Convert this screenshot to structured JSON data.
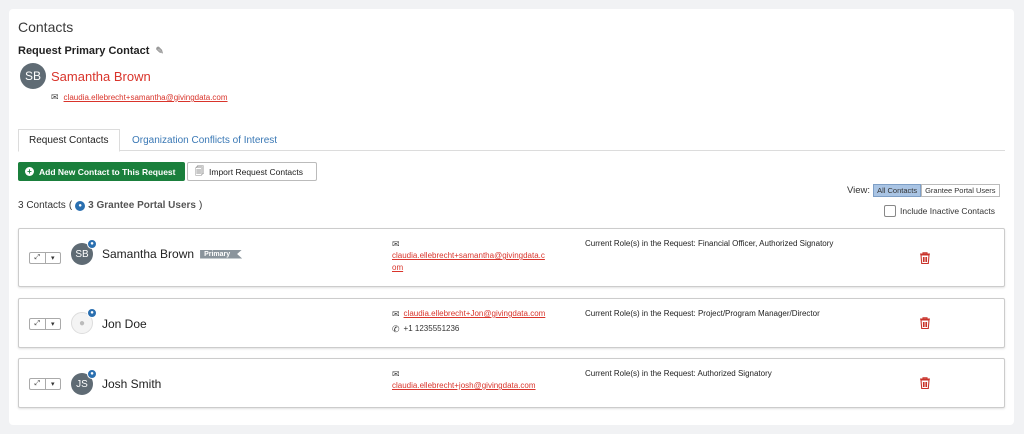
{
  "title": "Contacts",
  "primary_contact": {
    "label": "Request Primary Contact",
    "initials": "SB",
    "name": "Samantha Brown",
    "email": "claudia.ellebrecht+samantha@givingdata.com"
  },
  "tabs": [
    {
      "label": "Request Contacts",
      "active": true
    },
    {
      "label": "Organization Conflicts of Interest",
      "active": false
    }
  ],
  "buttons": {
    "add": "Add New Contact to This Request",
    "import": "Import Request Contacts"
  },
  "view": {
    "label": "View:",
    "options": [
      "All Contacts",
      "Grantee Portal Users"
    ],
    "selected": "All Contacts"
  },
  "summary": {
    "count": "3 Contacts",
    "open_paren": "(",
    "portal_users": "3 Grantee Portal Users",
    "close_paren": ")"
  },
  "include_inactive": {
    "label": "Include Inactive Contacts",
    "checked": false
  },
  "contacts": [
    {
      "initials": "SB",
      "name": "Samantha Brown",
      "badge": "Primary",
      "email": "claudia.ellebrecht+samantha@givingdata.com",
      "email_line1": "claudia.ellebrecht+samantha@givingdata.c",
      "email_line2": "om",
      "phone": "",
      "role": "Current Role(s) in the Request: Financial Officer, Authorized Signatory"
    },
    {
      "initials": "",
      "name": "Jon Doe",
      "badge": "",
      "email": "claudia.ellebrecht+Jon@givingdata.com",
      "phone": "+1 1235551236",
      "role": "Current Role(s) in the Request: Project/Program Manager/Director"
    },
    {
      "initials": "JS",
      "name": "Josh Smith",
      "badge": "",
      "email": "claudia.ellebrecht+josh@givingdata.com",
      "phone": "",
      "role": "Current Role(s) in the Request: Authorized Signatory"
    }
  ],
  "icons": {
    "edit": "pencil-icon",
    "mail": "envelope-icon",
    "phone": "phone-icon",
    "delete": "trash-icon",
    "expand": "expand-icon",
    "caret": "caret-down-icon",
    "portal": "user-circle-icon"
  },
  "colors": {
    "primary_name": "#d9342b",
    "add_button": "#1a7f3c",
    "link": "#3a78b5",
    "trash": "#c9332b",
    "avatar": "#5f6b74"
  }
}
